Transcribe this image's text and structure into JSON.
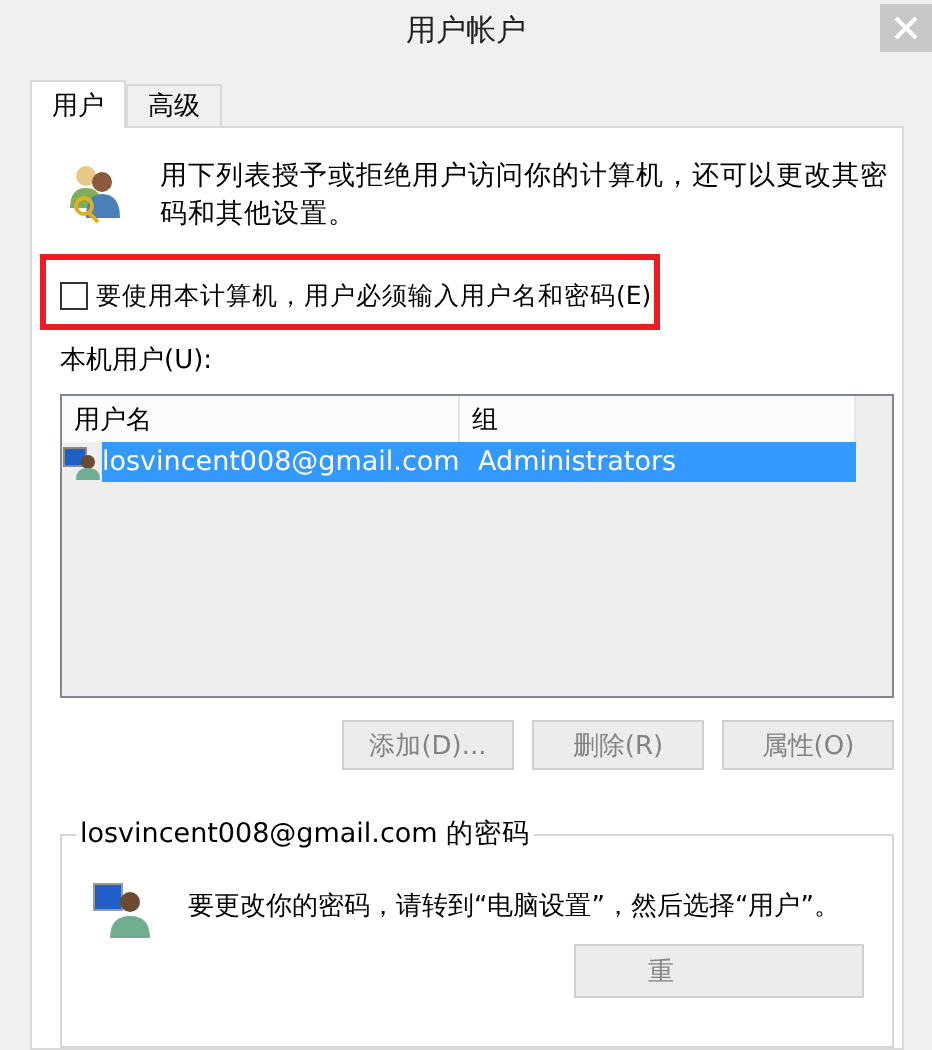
{
  "window": {
    "title": "用户帐户"
  },
  "tabs": [
    {
      "label": "用户",
      "selected": true
    },
    {
      "label": "高级",
      "selected": false
    }
  ],
  "intro": "用下列表授予或拒绝用户访问你的计算机，还可以更改其密码和其他设置。",
  "require_login": {
    "label": "要使用本计算机，用户必须输入用户名和密码(E)",
    "checked": false,
    "highlighted": true
  },
  "users_label": "本机用户(U):",
  "table": {
    "columns": [
      "用户名",
      "组"
    ],
    "rows": [
      {
        "cells": [
          "losvincent008@gmail.com",
          "Administrators"
        ],
        "selected": true
      }
    ]
  },
  "buttons": [
    {
      "label": "添加(D)...",
      "disabled": true
    },
    {
      "label": "删除(R)",
      "disabled": true
    },
    {
      "label": "属性(O)",
      "disabled": true
    }
  ],
  "password_group": {
    "title": "losvincent008@gmail.com 的密码",
    "text": "要更改你的密码，请转到“电脑设置”，然后选择“用户”。",
    "button": {
      "label": "重",
      "disabled": true
    }
  }
}
